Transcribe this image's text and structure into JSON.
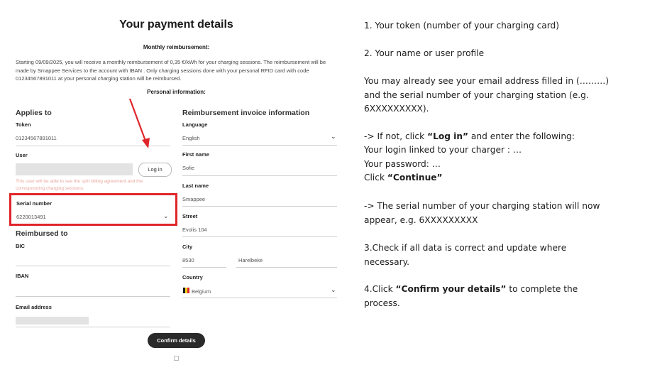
{
  "form": {
    "title": "Your payment details",
    "monthly_heading": "Monthly reimbursement:",
    "monthly_text": "Starting 09/09/2025, you will receive a monthly reimbursement of 0,35 €/kWh for your charging sessions. The reimbursement will be made by Smappee Services to the account with IBAN . Only charging sessions done with your personal RFID card with code 01234567891011 at your personal charging station will be reimbursed.",
    "personal_heading": "Personal information:",
    "applies_to": {
      "heading": "Applies to",
      "token_label": "Token",
      "token_value": "01234567891011",
      "user_label": "User",
      "login_label": "Log in",
      "user_hint": "This user will be able to see the split billing agreement and the corresponding charging sessions.",
      "serial_label": "Serial number",
      "serial_value": "6220013491"
    },
    "reimbursed_to": {
      "heading": "Reimbursed to",
      "bic_label": "BIC",
      "iban_label": "IBAN",
      "email_label": "Email address"
    },
    "invoice": {
      "heading": "Reimbursement invoice information",
      "language_label": "Language",
      "language_value": "English",
      "first_name_label": "First name",
      "first_name_value": "Sofie",
      "last_name_label": "Last name",
      "last_name_value": "Smappee",
      "street_label": "Street",
      "street_value": "Evolis 104",
      "city_label": "City",
      "postcode_value": "8530",
      "city_value": "Harelbeke",
      "country_label": "Country",
      "country_value": "Belgium"
    },
    "confirm_label": "Confirm details"
  },
  "instructions": {
    "step1": "1. Your token (number of your charging card)",
    "step2": "2. Your name or user profile",
    "email_note": "You may already see your email address filled in (………) and the serial number of your charging station (e.g. 6XXXXXXXXX).",
    "if_not_a": "-> If not, click ",
    "if_not_bold": "“Log in”",
    "if_not_b": " and enter the following:",
    "login_line": "Your login linked to your charger : …",
    "password_line": "Your password: …",
    "click_a": "Click ",
    "click_bold": "“Continue”",
    "serial_note": "-> The serial number of your charging station will now appear, e.g. 6XXXXXXXXX",
    "step3": "3.Check if all data is correct and update where necessary.",
    "step4_a": "4.Click ",
    "step4_bold": "“Confirm your details”",
    "step4_b": " to complete the process."
  },
  "colors": {
    "highlight": "#e0252a",
    "arrow": "#e0252a",
    "button": "#2a2a2a"
  }
}
